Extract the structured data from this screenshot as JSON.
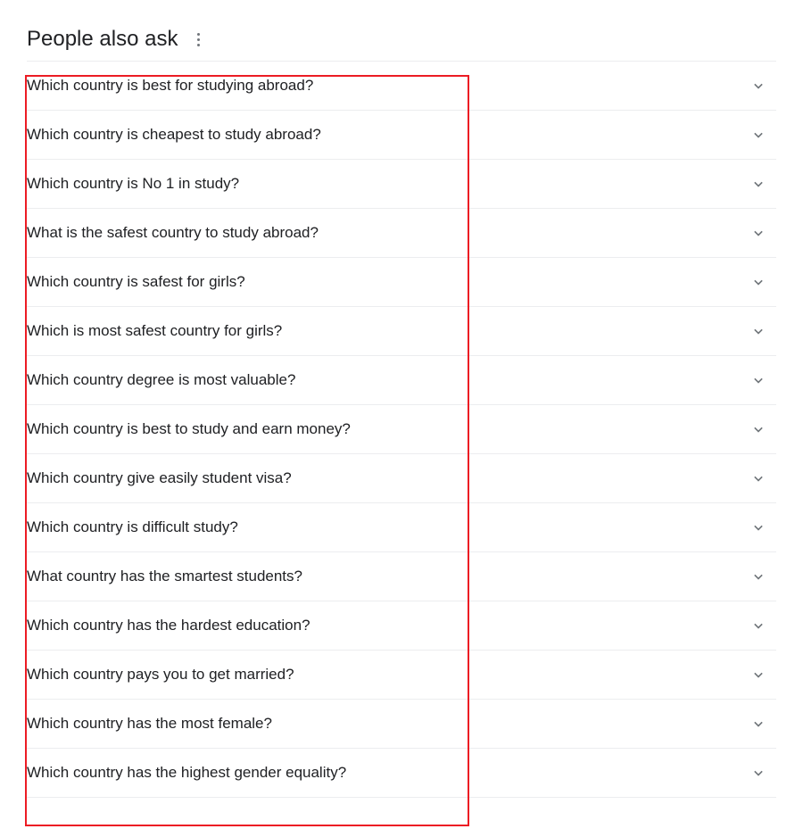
{
  "heading": "People also ask",
  "questions": [
    "Which country is best for studying abroad?",
    "Which country is cheapest to study abroad?",
    "Which country is No 1 in study?",
    "What is the safest country to study abroad?",
    "Which country is safest for girls?",
    "Which is most safest country for girls?",
    "Which country degree is most valuable?",
    "Which country is best to study and earn money?",
    "Which country give easily student visa?",
    "Which country is difficult study?",
    "What country has the smartest students?",
    "Which country has the hardest education?",
    "Which country pays you to get married?",
    "Which country has the most female?",
    "Which country has the highest gender equality?"
  ]
}
